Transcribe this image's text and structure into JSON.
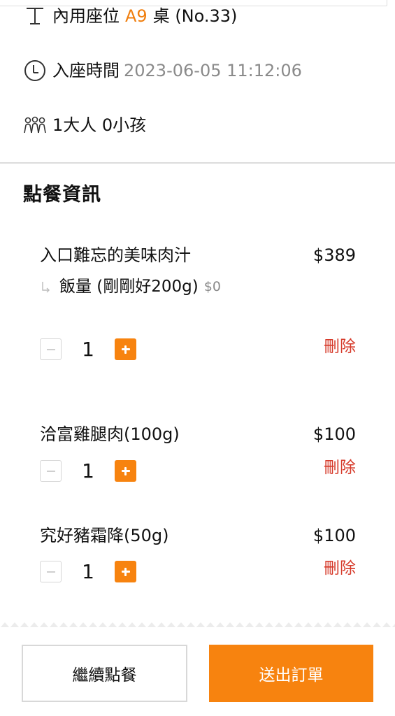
{
  "table_info": {
    "seat_prefix": "內用座位",
    "seat_code": "A9",
    "seat_suffix": "桌 (No.33)",
    "time_label": "入座時間",
    "time_value": "2023-06-05 11:12:06",
    "guests": "1大人 0小孩"
  },
  "order_section": {
    "title": "點餐資訊",
    "items": [
      {
        "name": "入口難忘的美味肉汁",
        "price": "$389",
        "option_name": "飯量 (剛剛好200g)",
        "option_price": "$0",
        "quantity": "1",
        "delete_label": "刪除"
      },
      {
        "name": "洽富雞腿肉(100g)",
        "price": "$100",
        "quantity": "1",
        "delete_label": "刪除"
      },
      {
        "name": "究好豬霜降(50g)",
        "price": "$100",
        "quantity": "1",
        "delete_label": "刪除"
      }
    ]
  },
  "footer": {
    "continue_label": "繼續點餐",
    "submit_label": "送出訂單"
  },
  "colors": {
    "accent": "#f7830f",
    "delete": "#d63a2a",
    "muted": "#8a8a8a"
  },
  "icons": [
    "table-icon",
    "clock-icon",
    "people-icon",
    "sub-option-arrow-icon",
    "minus-icon",
    "plus-icon"
  ]
}
